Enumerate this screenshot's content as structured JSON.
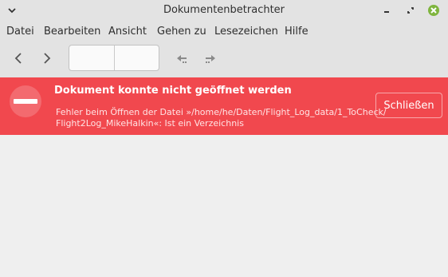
{
  "window": {
    "title": "Dokumentenbetrachter",
    "icons": {
      "menu": "chevron-down-icon",
      "minimize": "minimize-icon",
      "restore": "restore-icon",
      "close": "close-icon"
    },
    "close_color": "#7fb53e"
  },
  "menubar": {
    "items": [
      "Datei",
      "Bearbeiten",
      "Ansicht",
      "Gehen zu",
      "Lesezeichen",
      "Hilfe"
    ]
  },
  "toolbar": {
    "icons": [
      "back-icon",
      "forward-icon",
      "page-up-icon",
      "page-down-icon"
    ],
    "page_entry": {
      "value": "",
      "total": ""
    }
  },
  "error": {
    "heading": "Dokument konnte nicht geöffnet werden",
    "detail_line1": "Fehler beim Öffnen der Datei »/home/he/Daten/Flight_Log_data/1_ToCheck/",
    "detail_line2": "Flight2Log_MikeHalkin«: Ist ein Verzeichnis",
    "close_label": "Schließen",
    "icon": "error-dash-icon",
    "background": "#f1484e"
  }
}
